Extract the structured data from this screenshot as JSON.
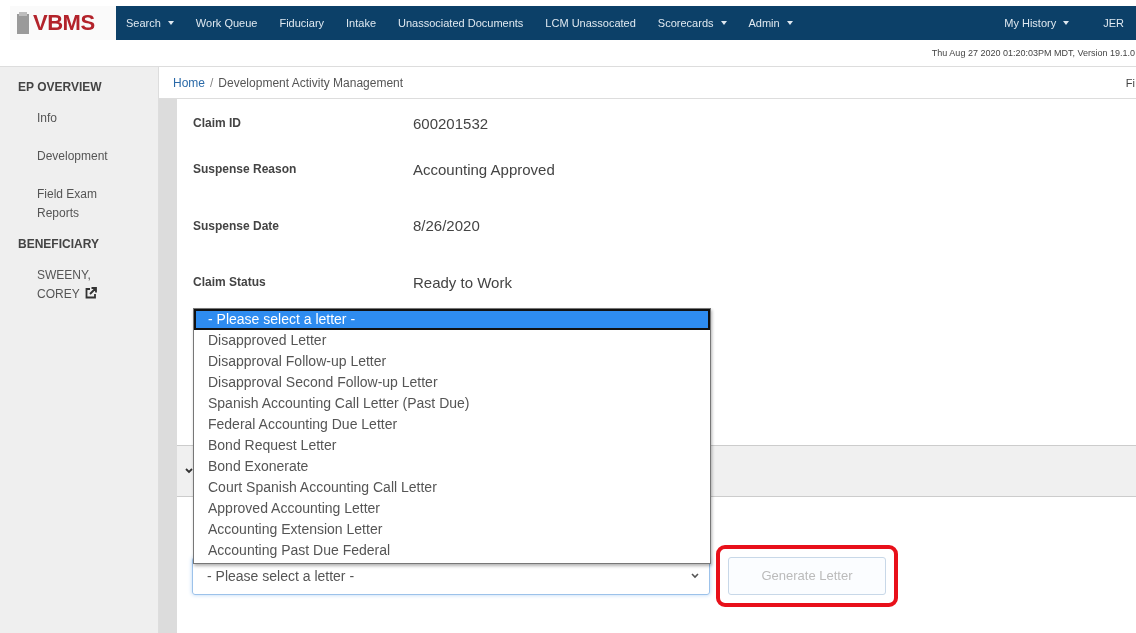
{
  "logo": {
    "text": "VBMS"
  },
  "nav": [
    {
      "label": "Search",
      "has_menu": true
    },
    {
      "label": "Work Queue",
      "has_menu": false
    },
    {
      "label": "Fiduciary",
      "has_menu": false
    },
    {
      "label": "Intake",
      "has_menu": false
    },
    {
      "label": "Unassociated Documents",
      "has_menu": false
    },
    {
      "label": "LCM Unassocated",
      "has_menu": false
    },
    {
      "label": "Scorecards",
      "has_menu": true
    },
    {
      "label": "Admin",
      "has_menu": true
    }
  ],
  "nav_right": [
    {
      "label": "My History",
      "has_menu": true
    },
    {
      "label": "JER",
      "has_menu": false
    }
  ],
  "timestamp": "Thu Aug 27 2020 01:20:03PM MDT, Version 19.1.0",
  "sidebar": [
    {
      "heading": "EP OVERVIEW",
      "items": [
        {
          "label": "Info",
          "external": false
        },
        {
          "label": "Development",
          "external": false
        },
        {
          "label": "Field Exam Reports",
          "external": false
        }
      ]
    },
    {
      "heading": "BENEFICIARY",
      "items": [
        {
          "label": "SWEENY, COREY",
          "external": true
        }
      ]
    }
  ],
  "breadcrumb": {
    "items": [
      "Home",
      "Development Activity Management"
    ],
    "separator": "/",
    "right": "Fi"
  },
  "fields": [
    {
      "label": "Claim ID",
      "value": "600201532"
    },
    {
      "label": "Suspense Reason",
      "value": "Accounting Approved"
    },
    {
      "label": "Suspense Date",
      "value": "8/26/2020"
    },
    {
      "label": "Claim Status",
      "value": "Ready to Work"
    }
  ],
  "letter_options": [
    {
      "label": "- Please select a letter -",
      "selected": true
    },
    {
      "label": "Disapproved Letter",
      "selected": false
    },
    {
      "label": "Disapproval Follow-up Letter",
      "selected": false
    },
    {
      "label": "Disapproval Second Follow-up Letter",
      "selected": false
    },
    {
      "label": "Spanish Accounting Call Letter (Past Due)",
      "selected": false
    },
    {
      "label": "Federal Accounting Due Letter",
      "selected": false
    },
    {
      "label": "Bond Request Letter",
      "selected": false
    },
    {
      "label": "Bond Exonerate",
      "selected": false
    },
    {
      "label": "Court Spanish Accounting Call Letter",
      "selected": false
    },
    {
      "label": "Approved Accounting Letter",
      "selected": false
    },
    {
      "label": "Accounting Extension Letter",
      "selected": false
    },
    {
      "label": "Accounting Past Due Federal",
      "selected": false
    }
  ],
  "letter_select": {
    "value": "- Please select a letter -"
  },
  "generate_button": {
    "label": "Generate Letter",
    "disabled": true,
    "highlighted": true
  }
}
